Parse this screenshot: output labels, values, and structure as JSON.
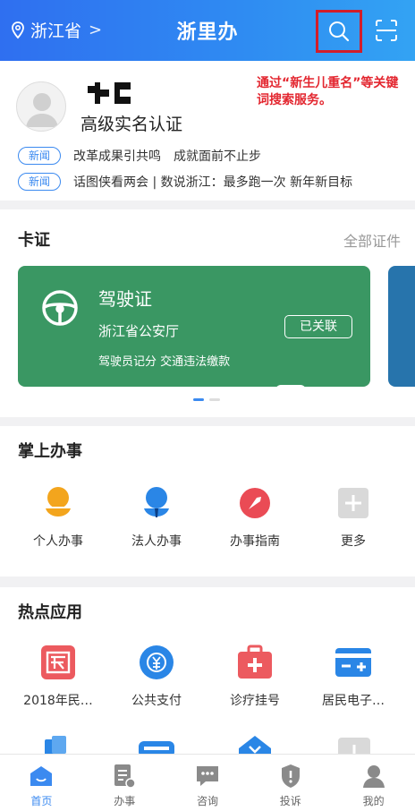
{
  "header": {
    "location": "浙江省",
    "location_chevron": ">",
    "title": "浙里办"
  },
  "profile": {
    "level": "高级实名认证",
    "search_hint": "通过“新生儿重名”等关键词搜索服务。",
    "news": [
      {
        "tag": "新闻",
        "text": "改革成果引共鸣　成就面前不止步"
      },
      {
        "tag": "新闻",
        "text": "话图侠看两会 | 数说浙江：最多跑一次 新年新目标"
      }
    ]
  },
  "cards": {
    "title": "卡证",
    "more": "全部证件",
    "license": {
      "name": "驾驶证",
      "dept": "浙江省公安厅",
      "sub": "驾驶员记分 交通违法缴款",
      "linked": "已关联"
    }
  },
  "handheld": {
    "title": "掌上办事",
    "items": [
      {
        "label": "个人办事",
        "icon": "person-icon"
      },
      {
        "label": "法人办事",
        "icon": "corporate-person-icon"
      },
      {
        "label": "办事指南",
        "icon": "compass-icon"
      },
      {
        "label": "更多",
        "icon": "plus-icon"
      }
    ]
  },
  "hot": {
    "title": "热点应用",
    "items": [
      {
        "label": "2018年民…",
        "icon": "tax-icon"
      },
      {
        "label": "公共支付",
        "icon": "yuan-icon"
      },
      {
        "label": "诊疗挂号",
        "icon": "medical-kit-icon"
      },
      {
        "label": "居民电子…",
        "icon": "card-icon"
      }
    ]
  },
  "tabs": [
    {
      "label": "首页",
      "icon": "home-icon"
    },
    {
      "label": "办事",
      "icon": "document-icon"
    },
    {
      "label": "咨询",
      "icon": "chat-icon"
    },
    {
      "label": "投诉",
      "icon": "shield-icon"
    },
    {
      "label": "我的",
      "icon": "user-icon"
    }
  ],
  "colors": {
    "header": "#2f7ff1",
    "accent": "#3b8af0",
    "license_card": "#3a9763",
    "hint_red": "#e3262f",
    "highlight_box": "#d21d2a"
  }
}
